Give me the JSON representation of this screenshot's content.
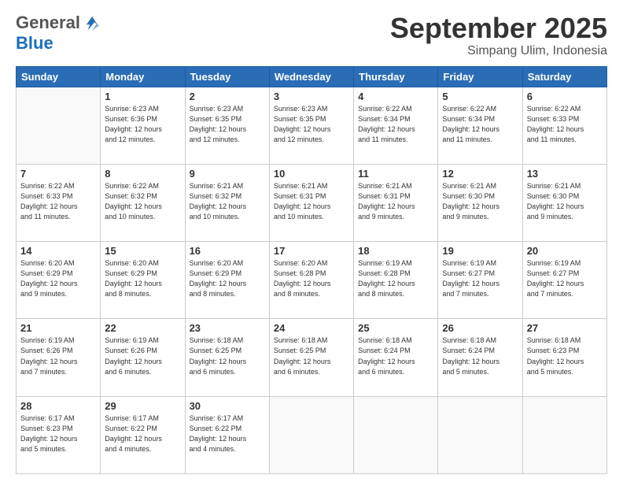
{
  "logo": {
    "general": "General",
    "blue": "Blue"
  },
  "header": {
    "month": "September 2025",
    "location": "Simpang Ulim, Indonesia"
  },
  "weekdays": [
    "Sunday",
    "Monday",
    "Tuesday",
    "Wednesday",
    "Thursday",
    "Friday",
    "Saturday"
  ],
  "weeks": [
    [
      {
        "day": "",
        "info": ""
      },
      {
        "day": "1",
        "info": "Sunrise: 6:23 AM\nSunset: 6:36 PM\nDaylight: 12 hours\nand 12 minutes."
      },
      {
        "day": "2",
        "info": "Sunrise: 6:23 AM\nSunset: 6:35 PM\nDaylight: 12 hours\nand 12 minutes."
      },
      {
        "day": "3",
        "info": "Sunrise: 6:23 AM\nSunset: 6:35 PM\nDaylight: 12 hours\nand 12 minutes."
      },
      {
        "day": "4",
        "info": "Sunrise: 6:22 AM\nSunset: 6:34 PM\nDaylight: 12 hours\nand 11 minutes."
      },
      {
        "day": "5",
        "info": "Sunrise: 6:22 AM\nSunset: 6:34 PM\nDaylight: 12 hours\nand 11 minutes."
      },
      {
        "day": "6",
        "info": "Sunrise: 6:22 AM\nSunset: 6:33 PM\nDaylight: 12 hours\nand 11 minutes."
      }
    ],
    [
      {
        "day": "7",
        "info": "Sunrise: 6:22 AM\nSunset: 6:33 PM\nDaylight: 12 hours\nand 11 minutes."
      },
      {
        "day": "8",
        "info": "Sunrise: 6:22 AM\nSunset: 6:32 PM\nDaylight: 12 hours\nand 10 minutes."
      },
      {
        "day": "9",
        "info": "Sunrise: 6:21 AM\nSunset: 6:32 PM\nDaylight: 12 hours\nand 10 minutes."
      },
      {
        "day": "10",
        "info": "Sunrise: 6:21 AM\nSunset: 6:31 PM\nDaylight: 12 hours\nand 10 minutes."
      },
      {
        "day": "11",
        "info": "Sunrise: 6:21 AM\nSunset: 6:31 PM\nDaylight: 12 hours\nand 9 minutes."
      },
      {
        "day": "12",
        "info": "Sunrise: 6:21 AM\nSunset: 6:30 PM\nDaylight: 12 hours\nand 9 minutes."
      },
      {
        "day": "13",
        "info": "Sunrise: 6:21 AM\nSunset: 6:30 PM\nDaylight: 12 hours\nand 9 minutes."
      }
    ],
    [
      {
        "day": "14",
        "info": "Sunrise: 6:20 AM\nSunset: 6:29 PM\nDaylight: 12 hours\nand 9 minutes."
      },
      {
        "day": "15",
        "info": "Sunrise: 6:20 AM\nSunset: 6:29 PM\nDaylight: 12 hours\nand 8 minutes."
      },
      {
        "day": "16",
        "info": "Sunrise: 6:20 AM\nSunset: 6:29 PM\nDaylight: 12 hours\nand 8 minutes."
      },
      {
        "day": "17",
        "info": "Sunrise: 6:20 AM\nSunset: 6:28 PM\nDaylight: 12 hours\nand 8 minutes."
      },
      {
        "day": "18",
        "info": "Sunrise: 6:19 AM\nSunset: 6:28 PM\nDaylight: 12 hours\nand 8 minutes."
      },
      {
        "day": "19",
        "info": "Sunrise: 6:19 AM\nSunset: 6:27 PM\nDaylight: 12 hours\nand 7 minutes."
      },
      {
        "day": "20",
        "info": "Sunrise: 6:19 AM\nSunset: 6:27 PM\nDaylight: 12 hours\nand 7 minutes."
      }
    ],
    [
      {
        "day": "21",
        "info": "Sunrise: 6:19 AM\nSunset: 6:26 PM\nDaylight: 12 hours\nand 7 minutes."
      },
      {
        "day": "22",
        "info": "Sunrise: 6:19 AM\nSunset: 6:26 PM\nDaylight: 12 hours\nand 6 minutes."
      },
      {
        "day": "23",
        "info": "Sunrise: 6:18 AM\nSunset: 6:25 PM\nDaylight: 12 hours\nand 6 minutes."
      },
      {
        "day": "24",
        "info": "Sunrise: 6:18 AM\nSunset: 6:25 PM\nDaylight: 12 hours\nand 6 minutes."
      },
      {
        "day": "25",
        "info": "Sunrise: 6:18 AM\nSunset: 6:24 PM\nDaylight: 12 hours\nand 6 minutes."
      },
      {
        "day": "26",
        "info": "Sunrise: 6:18 AM\nSunset: 6:24 PM\nDaylight: 12 hours\nand 5 minutes."
      },
      {
        "day": "27",
        "info": "Sunrise: 6:18 AM\nSunset: 6:23 PM\nDaylight: 12 hours\nand 5 minutes."
      }
    ],
    [
      {
        "day": "28",
        "info": "Sunrise: 6:17 AM\nSunset: 6:23 PM\nDaylight: 12 hours\nand 5 minutes."
      },
      {
        "day": "29",
        "info": "Sunrise: 6:17 AM\nSunset: 6:22 PM\nDaylight: 12 hours\nand 4 minutes."
      },
      {
        "day": "30",
        "info": "Sunrise: 6:17 AM\nSunset: 6:22 PM\nDaylight: 12 hours\nand 4 minutes."
      },
      {
        "day": "",
        "info": ""
      },
      {
        "day": "",
        "info": ""
      },
      {
        "day": "",
        "info": ""
      },
      {
        "day": "",
        "info": ""
      }
    ]
  ]
}
